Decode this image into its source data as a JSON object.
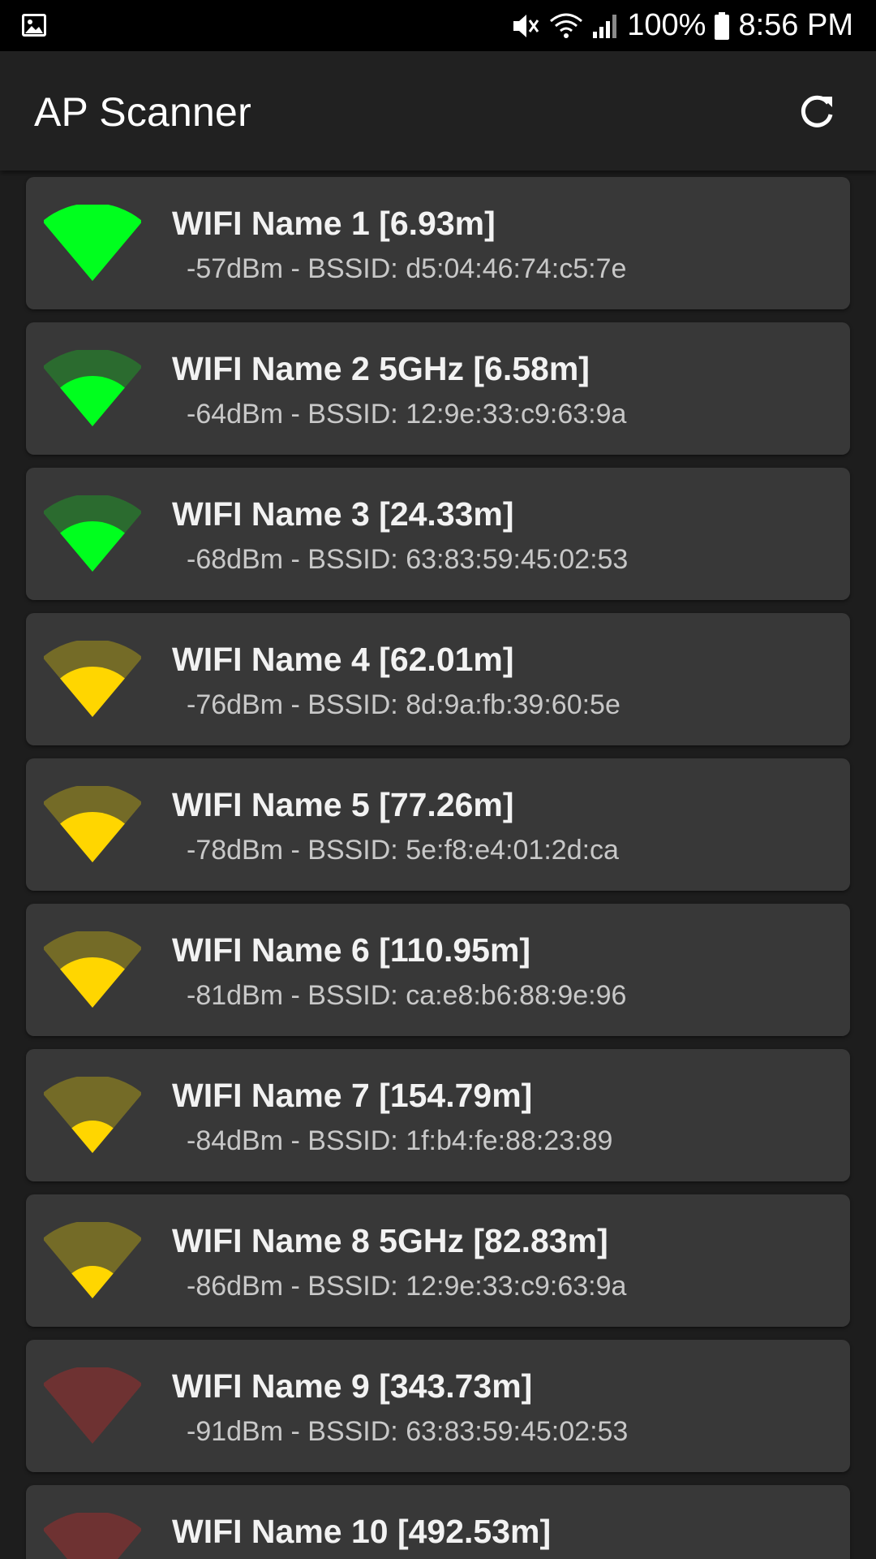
{
  "status_bar": {
    "icons": [
      "gallery-icon",
      "mute-icon",
      "wifi-icon",
      "cellular-icon",
      "battery-icon"
    ],
    "battery": "100%",
    "time": "8:56 PM"
  },
  "app_bar": {
    "title": "AP Scanner",
    "refresh_icon": "refresh-icon"
  },
  "colors": {
    "strong_fill": "#00ff1e",
    "strong_dim": "#2b6b2f",
    "medium_fill": "#ffd600",
    "medium_dim": "#746b27",
    "weak_fill": "#6e3232",
    "card_bg": "#383838"
  },
  "networks": [
    {
      "name": "WIFI Name 1 [6.93m]",
      "detail": "-57dBm - BSSID: d5:04:46:74:c5:7e",
      "level": 3,
      "color": "green"
    },
    {
      "name": "WIFI Name 2 5GHz [6.58m]",
      "detail": "-64dBm - BSSID: 12:9e:33:c9:63:9a",
      "level": 2,
      "color": "green"
    },
    {
      "name": "WIFI Name 3 [24.33m]",
      "detail": "-68dBm - BSSID: 63:83:59:45:02:53",
      "level": 2,
      "color": "green"
    },
    {
      "name": "WIFI Name 4 [62.01m]",
      "detail": "-76dBm - BSSID: 8d:9a:fb:39:60:5e",
      "level": 2,
      "color": "yellow"
    },
    {
      "name": "WIFI Name 5 [77.26m]",
      "detail": "-78dBm - BSSID: 5e:f8:e4:01:2d:ca",
      "level": 2,
      "color": "yellow"
    },
    {
      "name": "WIFI Name 6 [110.95m]",
      "detail": "-81dBm - BSSID: ca:e8:b6:88:9e:96",
      "level": 2,
      "color": "yellow"
    },
    {
      "name": "WIFI Name 7 [154.79m]",
      "detail": "-84dBm - BSSID: 1f:b4:fe:88:23:89",
      "level": 1,
      "color": "yellow"
    },
    {
      "name": "WIFI Name 8 5GHz [82.83m]",
      "detail": "-86dBm - BSSID: 12:9e:33:c9:63:9a",
      "level": 1,
      "color": "yellow"
    },
    {
      "name": "WIFI Name 9 [343.73m]",
      "detail": "-91dBm - BSSID: 63:83:59:45:02:53",
      "level": 0,
      "color": "red"
    },
    {
      "name": "WIFI Name 10 [492.53m]",
      "detail": "",
      "level": 0,
      "color": "red"
    }
  ]
}
